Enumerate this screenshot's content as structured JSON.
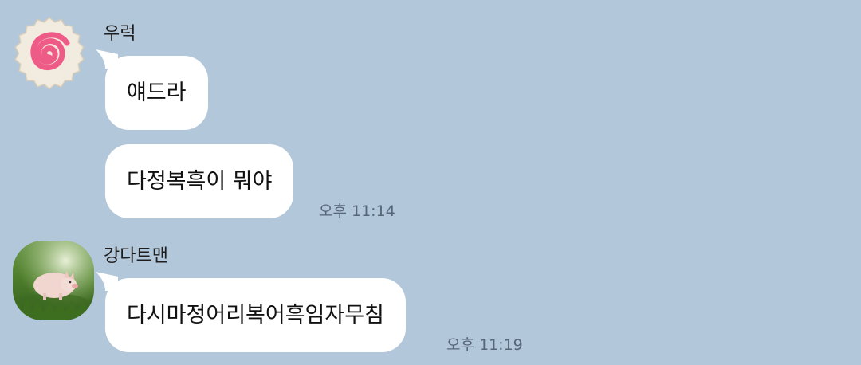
{
  "messages": [
    {
      "sender": "우럭",
      "avatar_icon": "narutomaki-icon",
      "bubbles": [
        "얘드라",
        "다정복흑이 뭐야"
      ],
      "time": "오후 11:14"
    },
    {
      "sender": "강다트맨",
      "avatar_icon": "piglet-photo",
      "bubbles": [
        "다시마정어리복어흑임자무침"
      ],
      "time": "오후 11:19"
    }
  ],
  "colors": {
    "background": "#b2c7d9",
    "bubble": "#ffffff",
    "timestamp": "#556677",
    "narutomaki_swirl": "#ee5b86"
  }
}
